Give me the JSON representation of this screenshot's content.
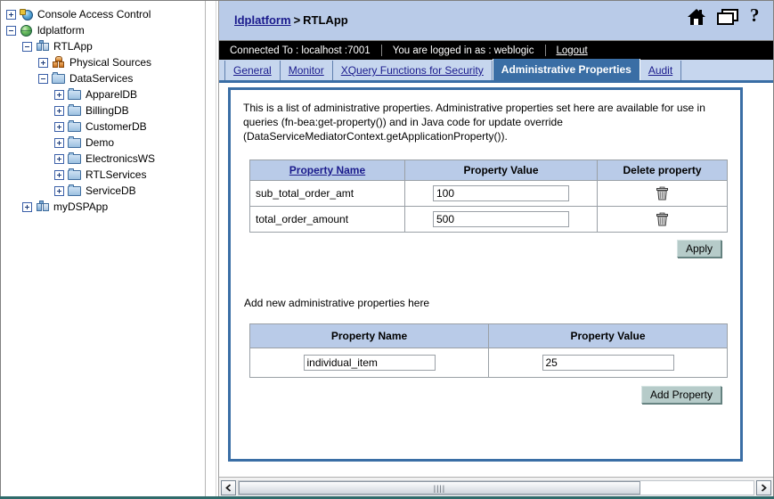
{
  "sidebar": {
    "tree": [
      {
        "label": "Console Access Control",
        "indent": 0,
        "toggle": "plus",
        "icon": "lock-globe-icon"
      },
      {
        "label": "ldplatform",
        "indent": 0,
        "toggle": "minus",
        "icon": "globe-icon"
      },
      {
        "label": "RTLApp",
        "indent": 1,
        "toggle": "minus",
        "icon": "application-icon"
      },
      {
        "label": "Physical Sources",
        "indent": 2,
        "toggle": "plus",
        "icon": "physical-sources-icon"
      },
      {
        "label": "DataServices",
        "indent": 2,
        "toggle": "minus",
        "icon": "folder-icon"
      },
      {
        "label": "ApparelDB",
        "indent": 3,
        "toggle": "plus",
        "icon": "folder-icon"
      },
      {
        "label": "BillingDB",
        "indent": 3,
        "toggle": "plus",
        "icon": "folder-icon"
      },
      {
        "label": "CustomerDB",
        "indent": 3,
        "toggle": "plus",
        "icon": "folder-icon"
      },
      {
        "label": "Demo",
        "indent": 3,
        "toggle": "plus",
        "icon": "folder-icon"
      },
      {
        "label": "ElectronicsWS",
        "indent": 3,
        "toggle": "plus",
        "icon": "folder-icon"
      },
      {
        "label": "RTLServices",
        "indent": 3,
        "toggle": "plus",
        "icon": "folder-icon"
      },
      {
        "label": "ServiceDB",
        "indent": 3,
        "toggle": "plus",
        "icon": "folder-icon"
      },
      {
        "label": "myDSPApp",
        "indent": 1,
        "toggle": "plus",
        "icon": "application-icon"
      }
    ]
  },
  "header": {
    "breadcrumb_root": "ldplatform",
    "breadcrumb_separator": ">",
    "breadcrumb_current": "RTLApp",
    "icons": [
      "home-icon",
      "windows-icon",
      "help-icon"
    ]
  },
  "status": {
    "connected_label": "Connected To :  localhost :7001",
    "user_label": "You are logged in as :  weblogic",
    "logout_label": "Logout"
  },
  "tabs": [
    {
      "label": "General",
      "active": false
    },
    {
      "label": "Monitor",
      "active": false
    },
    {
      "label": "XQuery Functions for Security",
      "active": false
    },
    {
      "label": "Administrative Properties",
      "active": true
    },
    {
      "label": "Audit",
      "active": false
    }
  ],
  "panel": {
    "description": "This is a list of administrative properties. Administrative properties set here are available for use in queries (fn-bea:get-property()) and in Java code for update override (DataServiceMediatorContext.getApplicationProperty()).",
    "properties_table": {
      "headers": [
        "Property Name",
        "Property Value",
        "Delete property"
      ],
      "rows": [
        {
          "name": "sub_total_order_amt",
          "value": "100",
          "delete_icon": "trash-icon"
        },
        {
          "name": "total_order_amount",
          "value": "500",
          "delete_icon": "trash-icon"
        }
      ]
    },
    "apply_label": "Apply",
    "add_section_label": "Add new administrative properties here",
    "add_table": {
      "headers": [
        "Property Name",
        "Property Value"
      ],
      "row": {
        "name": "individual_item",
        "value": "25"
      }
    },
    "add_property_label": "Add Property"
  },
  "scrollbar": {
    "left_arrow": "chevron-left-icon",
    "right_arrow": "chevron-right-icon",
    "grip": "||||"
  },
  "colors": {
    "header_blue": "#b9cbe8",
    "tabbar_blue": "#c6d6ee",
    "active_tab": "#3a6ea5",
    "panel_border": "#3a6ea5",
    "status_bar": "#000000",
    "button_face": "#b6cbc9",
    "link": "#1a1a8c",
    "bottom_rule": "#2f6b6b"
  }
}
